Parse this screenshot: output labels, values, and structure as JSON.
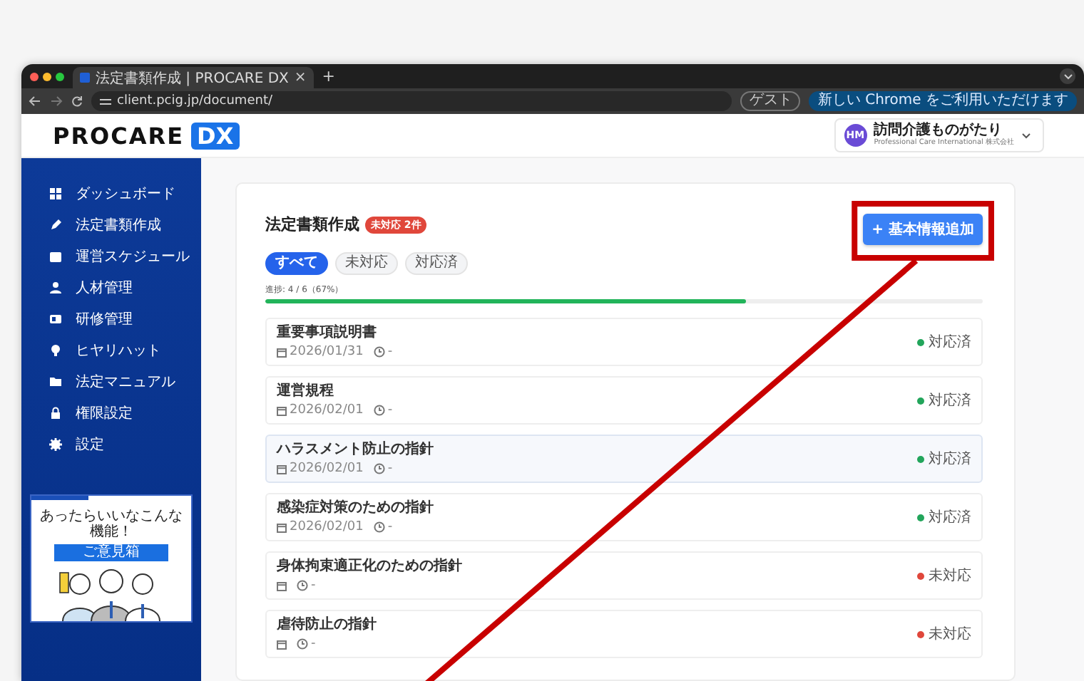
{
  "browser": {
    "tab_title": "法定書類作成 | PROCARE DX",
    "tab_close": "×",
    "new_tab": "+",
    "url": "client.pcig.jp/document/",
    "guest_label": "ゲスト",
    "update_label": "新しい Chrome をご利用いただけます"
  },
  "header": {
    "logo_text": "PROCARE",
    "logo_badge": "DX",
    "avatar": "HM",
    "org_name": "訪問介護ものがたり",
    "org_sub": "Professional Care International 株式会社"
  },
  "sidebar": {
    "items": [
      {
        "label": "ダッシュボード",
        "selected": false
      },
      {
        "label": "法定書類作成",
        "selected": false
      },
      {
        "label": "運営スケジュール",
        "selected": false
      },
      {
        "label": "人材管理",
        "selected": false
      },
      {
        "label": "研修管理",
        "selected": false
      },
      {
        "label": "ヒヤリハット",
        "selected": false
      },
      {
        "label": "法定マニュアル",
        "selected": false
      },
      {
        "label": "権限設定",
        "selected": false
      },
      {
        "label": "設定",
        "selected": false
      }
    ],
    "banner": {
      "text": "あったらいいなこんな機能！",
      "button": "ご意見箱"
    }
  },
  "page": {
    "title": "法定書類作成",
    "badge": "未対応 2件",
    "add_button": "+ 基本情報追加",
    "filters": [
      {
        "label": "すべて",
        "selected": true
      },
      {
        "label": "未対応",
        "selected": false
      },
      {
        "label": "対応済",
        "selected": false
      }
    ],
    "progress_label": "進捗: 4 / 6（67%）",
    "progress": {
      "level": 0.67
    },
    "documents": [
      {
        "title": "重要事項説明書",
        "date": "2026/01/31",
        "time": "-",
        "status": "対応済",
        "color": "#22a55b",
        "selected": false
      },
      {
        "title": "運営規程",
        "date": "2026/02/01",
        "time": "-",
        "status": "対応済",
        "color": "#22a55b",
        "selected": false
      },
      {
        "title": "ハラスメント防止の指針",
        "date": "2026/02/01",
        "time": "-",
        "status": "対応済",
        "color": "#22a55b",
        "selected": true
      },
      {
        "title": "感染症対策のための指針",
        "date": "2026/02/01",
        "time": "-",
        "status": "対応済",
        "color": "#22a55b",
        "selected": false
      },
      {
        "title": "身体拘束適正化のための指針",
        "time": "-",
        "status": "未対応",
        "color": "#e0473b",
        "selected": false
      },
      {
        "title": "虐待防止の指針",
        "time": "-",
        "status": "未対応",
        "color": "#e0473b",
        "selected": false
      }
    ]
  }
}
